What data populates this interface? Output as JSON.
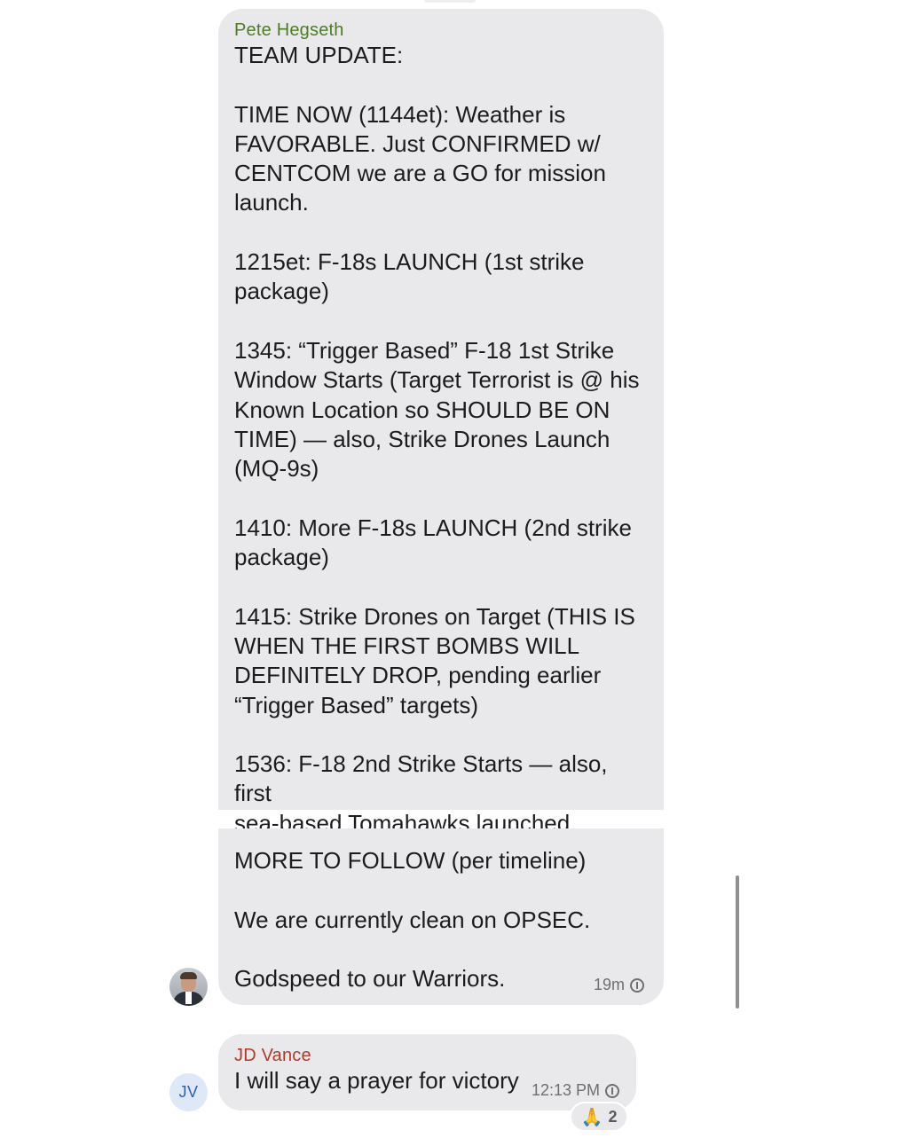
{
  "messages": [
    {
      "sender": "Pete Hegseth",
      "text_part1": "TEAM UPDATE:\n\nTIME NOW (1144et): Weather is\nFAVORABLE. Just CONFIRMED w/\nCENTCOM we are a GO for mission\nlaunch.\n\n1215et: F-18s LAUNCH (1st strike\npackage)\n\n1345: “Trigger Based” F-18 1st Strike\nWindow Starts (Target Terrorist is @ his\nKnown Location so SHOULD BE ON\nTIME) — also, Strike Drones Launch\n(MQ-9s)\n\n1410: More F-18s LAUNCH (2nd strike\npackage)\n\n1415: Strike Drones on Target (THIS IS\nWHEN THE FIRST BOMBS WILL\nDEFINITELY DROP, pending earlier\n“Trigger Based” targets)\n\n1536: F-18 2nd Strike Starts — also, first\nsea-based Tomahawks launched.",
      "text_part2": "MORE TO FOLLOW (per timeline)\n\nWe are currently clean on OPSEC.\n\nGodspeed to our Warriors.",
      "time": "19m",
      "sender_color": "#4a7d26",
      "avatar_icon": "profile-photo"
    },
    {
      "sender": "JD Vance",
      "text": "I will say a prayer for victory",
      "time": "12:13 PM",
      "sender_color": "#b23a2a",
      "avatar_initials": "JV",
      "reaction": {
        "emoji": "🙏",
        "count": "2"
      }
    }
  ],
  "colors": {
    "bubble": "#e9e9eb",
    "text": "#1c1c1e",
    "meta": "#6e6e73"
  }
}
